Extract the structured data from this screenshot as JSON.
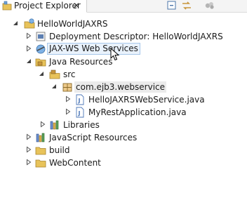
{
  "view": {
    "title": "Project Explorer",
    "close_glyph": "✕"
  },
  "toolbar": [
    {
      "name": "collapse-all-icon"
    },
    {
      "name": "link-with-editor-icon"
    },
    {
      "name": "view-menu-icon"
    }
  ],
  "tree": {
    "project": "HelloWorldJAXRS",
    "deployment_descriptor": "Deployment Descriptor: HelloWorldJAXRS",
    "jaxws": "JAX-WS Web Services",
    "java_resources": "Java Resources",
    "src": "src",
    "package": "com.ejb3.webservice",
    "file1": "HelloJAXRSWebService.java",
    "file2": "MyRestApplication.java",
    "libraries": "Libraries",
    "js_resources": "JavaScript Resources",
    "build": "build",
    "webcontent": "WebContent"
  },
  "colors": {
    "folder": "#e8c35a",
    "package": "#c8963c",
    "java_file": "#4d77b8",
    "hover": "#e9f2fc",
    "selection": "#ebebeb"
  }
}
